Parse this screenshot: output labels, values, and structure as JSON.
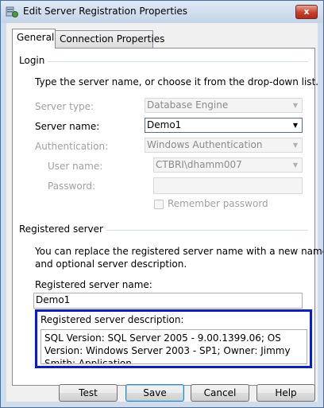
{
  "window": {
    "title": "Edit Server Registration Properties",
    "close_glyph": "x"
  },
  "tabs": [
    {
      "label": "General"
    },
    {
      "label": "Connection Properties"
    }
  ],
  "login": {
    "heading": "Login",
    "instruction": "Type the server name, or choose it from the drop-down list.",
    "server_type_label": "Server type:",
    "server_type_value": "Database Engine",
    "server_name_label": "Server name:",
    "server_name_value": "Demo1",
    "authentication_label": "Authentication:",
    "authentication_value": "Windows Authentication",
    "user_name_label": "User name:",
    "user_name_value": "CTBRI\\dhamm007",
    "password_label": "Password:",
    "password_value": "",
    "remember_password_label": "Remember password"
  },
  "registered": {
    "heading": "Registered server",
    "instruction_line1": "You can replace the registered server name with a new name",
    "instruction_line2": "and optional server description.",
    "name_label": "Registered server name:",
    "name_value": "Demo1",
    "description_label": "Registered server description:",
    "description_value": "SQL Version: SQL Server 2005 - 9.00.1399.06; OS Version: Windows Server 2003 - SP1; Owner: Jimmy Smith; Application"
  },
  "buttons": {
    "test": "Test",
    "save": "Save",
    "cancel": "Cancel",
    "help": "Help"
  },
  "colors": {
    "highlight_border": "#0a1ccf",
    "window_frame": "#cfdcec"
  }
}
